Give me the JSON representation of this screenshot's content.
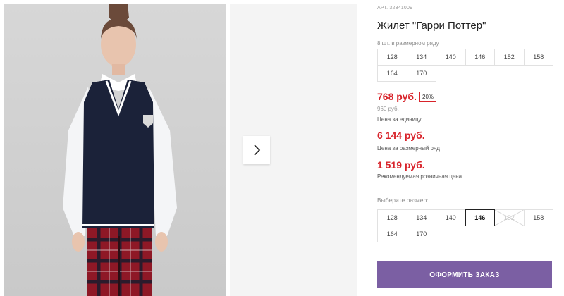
{
  "product": {
    "sku": "АРТ. 32341009",
    "title": "Жилет \"Гарри Поттер\""
  },
  "size_range": {
    "hint": "8 шт. в размерном ряду",
    "sizes": [
      "128",
      "134",
      "140",
      "146",
      "152",
      "158",
      "164",
      "170"
    ]
  },
  "pricing": {
    "unit_price": "768 руб.",
    "discount": "20%",
    "old_price": "960 руб.",
    "unit_label": "Цена за единицу",
    "range_price": "6 144 руб.",
    "range_label": "Цена за размерный ряд",
    "retail_price": "1 519 руб.",
    "retail_label": "Рекомендуемая розничная цена"
  },
  "size_select": {
    "label": "Выберите размер:",
    "sizes": [
      "128",
      "134",
      "140",
      "146",
      "152",
      "158",
      "164",
      "170"
    ],
    "selected": "146",
    "unavailable": "152"
  },
  "actions": {
    "order_label": "ОФОРМИТЬ ЗАКАЗ"
  },
  "colors": {
    "accent": "#7b5fa3",
    "price_red": "#d8232a"
  },
  "icons": {
    "gallery_next": "chevron-right-icon"
  }
}
